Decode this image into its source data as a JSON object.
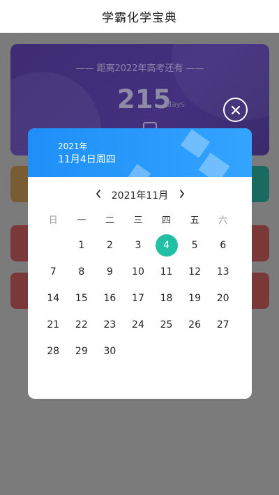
{
  "header": {
    "title": "学霸化学宝典"
  },
  "countdown": {
    "caption": "—— 距离2022年高考还有 ——",
    "days_value": "215",
    "days_unit": "days"
  },
  "dialog": {
    "year": "2021年",
    "date": "11月4日周四",
    "month_label": "2021年11月",
    "weekdays": [
      "日",
      "一",
      "二",
      "三",
      "四",
      "五",
      "六"
    ],
    "weeks": [
      [
        "",
        "1",
        "2",
        "3",
        "4",
        "5",
        "6"
      ],
      [
        "7",
        "8",
        "9",
        "10",
        "11",
        "12",
        "13"
      ],
      [
        "14",
        "15",
        "16",
        "17",
        "18",
        "19",
        "20"
      ],
      [
        "21",
        "22",
        "23",
        "24",
        "25",
        "26",
        "27"
      ],
      [
        "28",
        "29",
        "30",
        "",
        "",
        "",
        ""
      ]
    ],
    "selected_day": "4"
  },
  "colors": {
    "header_gradient_start": "#1e8ff7",
    "selected_day_bg": "#21bfa6",
    "overlay": "#7b7b7b"
  }
}
